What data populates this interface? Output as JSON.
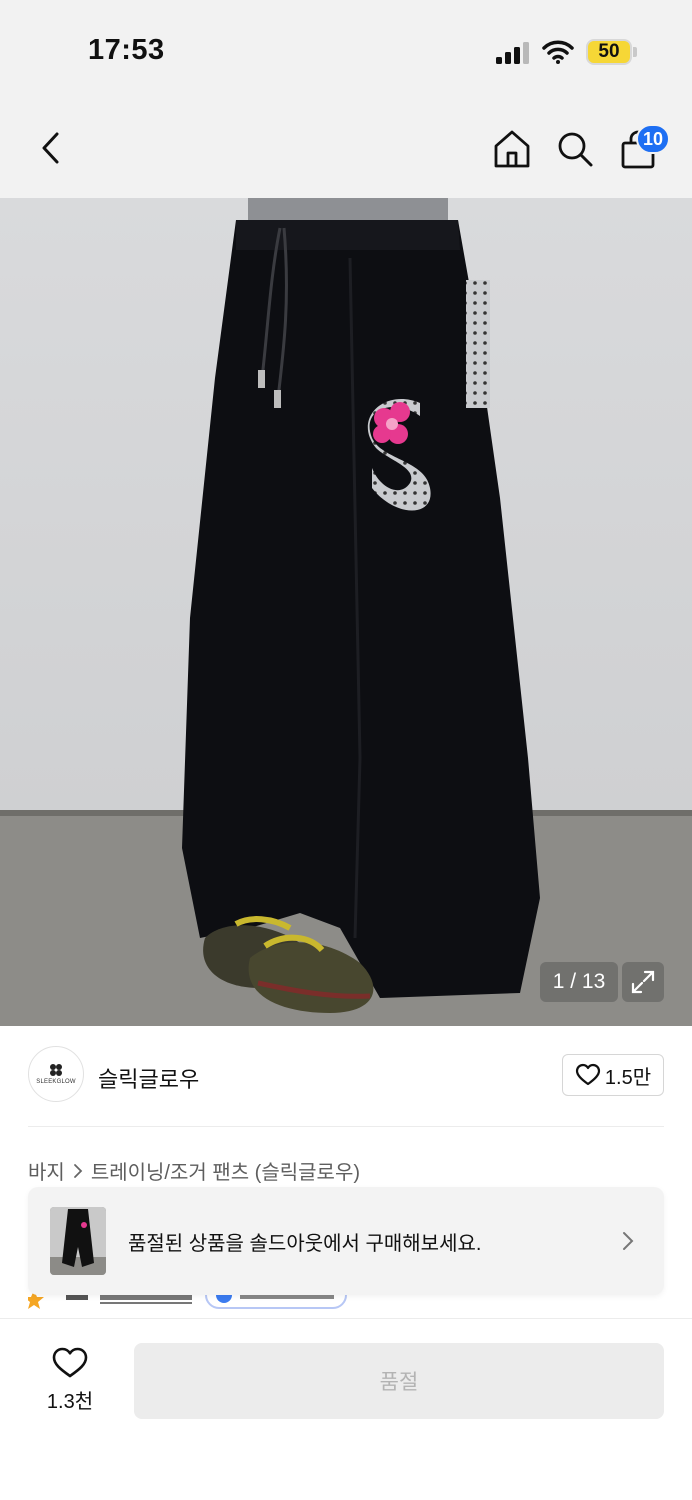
{
  "status_bar": {
    "time": "17:53",
    "battery": "50",
    "icons": [
      "signal-icon",
      "wifi-icon",
      "battery-icon"
    ]
  },
  "nav": {
    "icons": [
      "back-icon",
      "home-icon",
      "search-icon",
      "cart-icon"
    ],
    "cart_badge": "10"
  },
  "gallery": {
    "counter": "1 / 13",
    "expand_icon": "expand-icon"
  },
  "brand": {
    "name": "슬릭글로우",
    "logo_text": "SLEEKGLOW",
    "like_count": "1.5만"
  },
  "breadcrumb": {
    "category": "바지",
    "subcategory": "트레이닝/조거 팬츠 (슬릭글로우)"
  },
  "soldout_banner": {
    "text": "품절된 상품을 솔드아웃에서 구매해보세요."
  },
  "bottom": {
    "wish_count": "1.3천",
    "status_button": "품절"
  },
  "colors": {
    "accent_blue": "#1e6ff3",
    "battery_yellow": "#f6d736",
    "header_gray": "#f2f2f2"
  }
}
